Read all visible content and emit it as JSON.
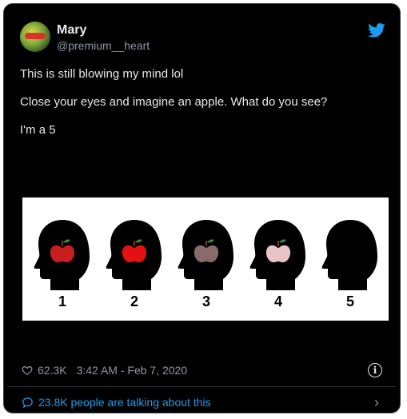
{
  "author": {
    "name": "Mary",
    "handle": "@premium__heart"
  },
  "tweet": {
    "lines": [
      "This is still blowing my mind lol",
      "Close your eyes and imagine an apple. What do you see?",
      "I'm a 5"
    ]
  },
  "media": {
    "heads": [
      {
        "label": "1",
        "apple_color": "#c81e1e"
      },
      {
        "label": "2",
        "apple_color": "#e31212"
      },
      {
        "label": "3",
        "apple_color": "#8a6a6a"
      },
      {
        "label": "4",
        "apple_color": "#e8c3c8"
      },
      {
        "label": "5",
        "apple_color": ""
      }
    ]
  },
  "stats": {
    "likes": "62.3K",
    "timestamp": "3:42 AM - Feb 7, 2020"
  },
  "footer": {
    "talking": "23.8K people are talking about this"
  },
  "colors": {
    "accent": "#1d9bf0",
    "background": "#000000"
  }
}
